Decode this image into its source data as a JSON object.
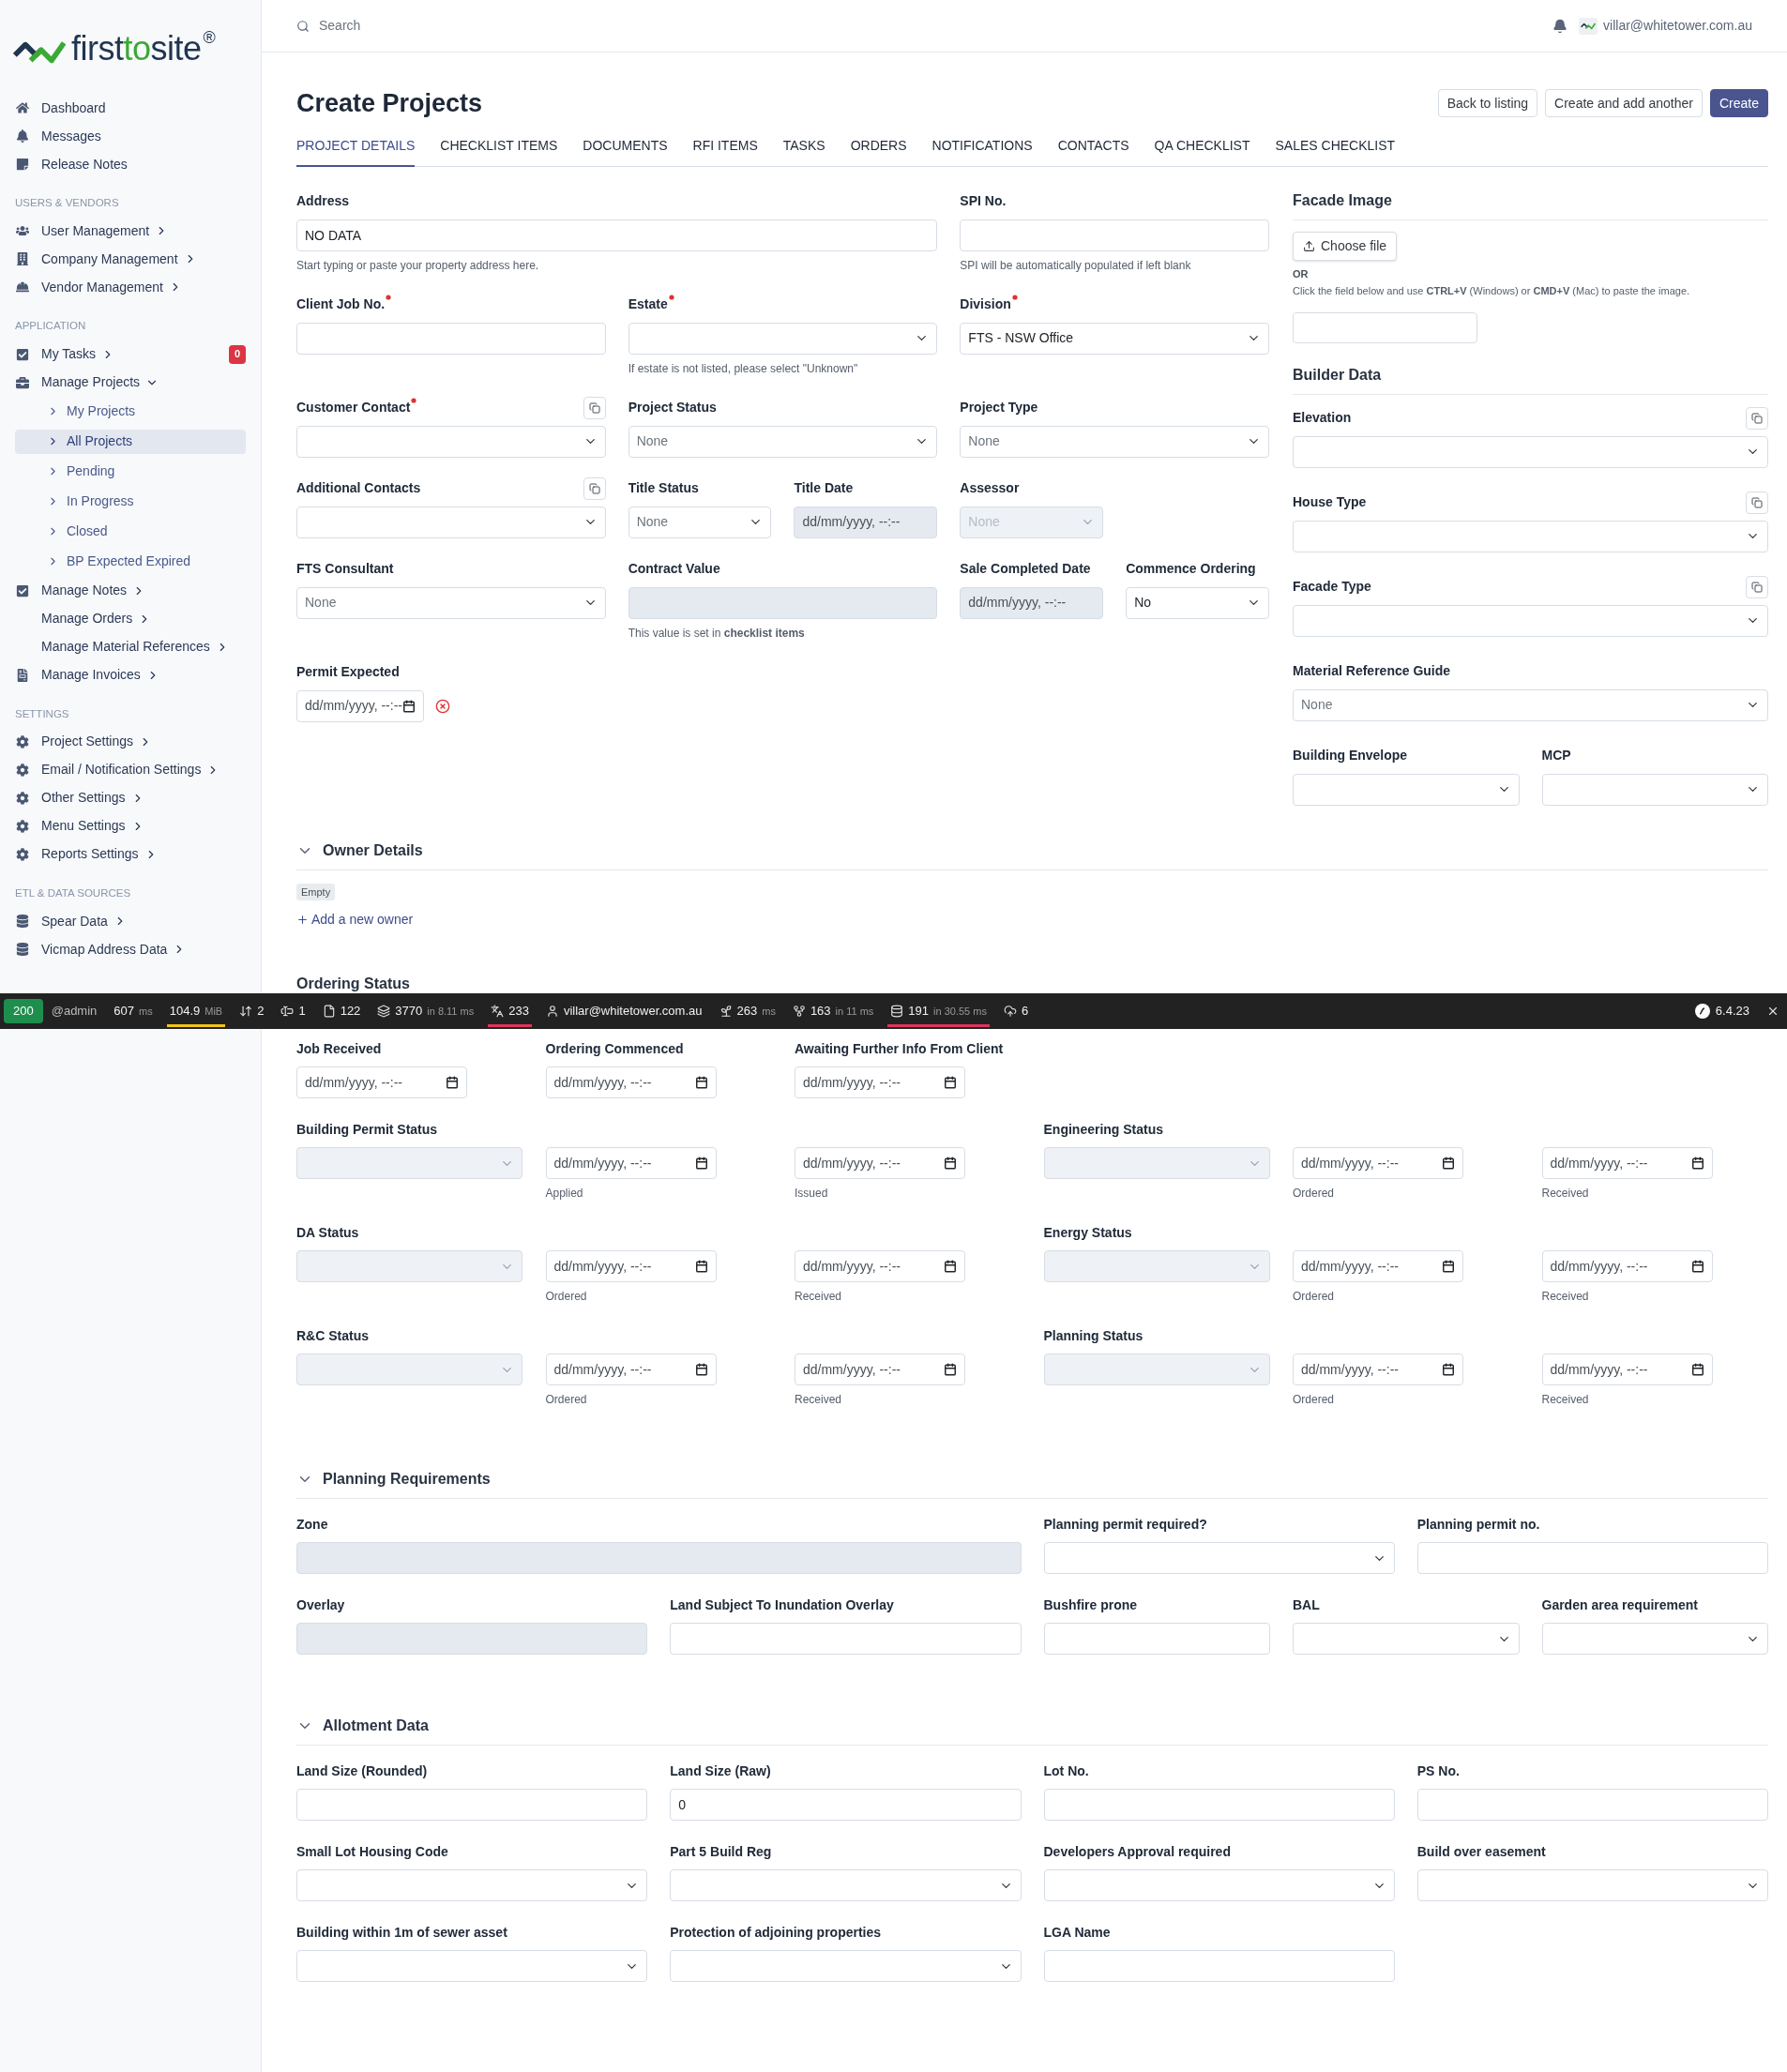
{
  "sidebar": {
    "logo": {
      "part_1": "first",
      "part_2": "to",
      "part_3": "site",
      "registered": "®"
    },
    "sections": [
      {
        "items": [
          {
            "label": "Dashboard"
          },
          {
            "label": "Messages"
          },
          {
            "label": "Release Notes"
          }
        ]
      },
      {
        "title": "USERS & VENDORS",
        "items": [
          {
            "label": "User Management",
            "expanded": false
          },
          {
            "label": "Company Management",
            "expanded": false
          },
          {
            "label": "Vendor Management",
            "expanded": false
          }
        ]
      },
      {
        "title": "APPLICATION",
        "items": [
          {
            "label": "My Tasks",
            "expanded": false,
            "badge": "0"
          },
          {
            "label": "Manage Projects",
            "expanded": true,
            "children": [
              {
                "label": "My Projects",
                "selected": false
              },
              {
                "label": "All Projects",
                "selected": true
              },
              {
                "label": "Pending",
                "selected": false
              },
              {
                "label": "In Progress",
                "selected": false
              },
              {
                "label": "Closed",
                "selected": false
              },
              {
                "label": "BP Expected Expired",
                "selected": false
              }
            ]
          },
          {
            "label": "Manage Notes",
            "expanded": false
          },
          {
            "label": "Manage Orders",
            "expanded": false
          },
          {
            "label": "Manage Material References",
            "expanded": false
          },
          {
            "label": "Manage Invoices",
            "expanded": false
          }
        ]
      },
      {
        "title": "SETTINGS",
        "items": [
          {
            "label": "Project Settings",
            "expanded": false
          },
          {
            "label": "Email / Notification Settings",
            "expanded": false
          },
          {
            "label": "Other Settings",
            "expanded": false
          },
          {
            "label": "Menu Settings",
            "expanded": false
          },
          {
            "label": "Reports Settings",
            "expanded": false
          }
        ]
      },
      {
        "title": "ETL & DATA SOURCES",
        "items": [
          {
            "label": "Spear Data",
            "expanded": false
          },
          {
            "label": "Vicmap Address Data",
            "expanded": false
          }
        ]
      }
    ]
  },
  "header": {
    "search": {
      "placeholder": "Search"
    },
    "user": {
      "email": "villar@whitetower.com.au"
    }
  },
  "page": {
    "title": "Create Projects",
    "actions": [
      {
        "label": "Back to listing",
        "primary": false
      },
      {
        "label": "Create and add another",
        "primary": false
      },
      {
        "label": "Create",
        "primary": true
      }
    ],
    "tabs": [
      {
        "label": "PROJECT DETAILS",
        "selected": true
      },
      {
        "label": "CHECKLIST ITEMS",
        "selected": false
      },
      {
        "label": "DOCUMENTS",
        "selected": false
      },
      {
        "label": "RFI ITEMS",
        "selected": false
      },
      {
        "label": "TASKS",
        "selected": false
      },
      {
        "label": "ORDERS",
        "selected": false
      },
      {
        "label": "NOTIFICATIONS",
        "selected": false
      },
      {
        "label": "CONTACTS",
        "selected": false
      },
      {
        "label": "QA CHECKLIST",
        "selected": false
      },
      {
        "label": "SALES CHECKLIST",
        "selected": false
      }
    ]
  },
  "form": {
    "rows": [
      [
        {
          "label": "Address",
          "kind": "text",
          "disabled": false,
          "value": "NO DATA",
          "help": "Start typing or paste your property address here."
        },
        null,
        {
          "label": "SPI No.",
          "kind": "text",
          "disabled": false,
          "help": "SPI will be automatically populated if left blank"
        }
      ],
      [
        {
          "label": "Client Job No.",
          "kind": "text",
          "required": true,
          "disabled": false
        },
        {
          "label": "Estate",
          "kind": "select",
          "required": true,
          "disabled": false,
          "help": "If estate is not listed, please select \"Unknown\""
        },
        {
          "label": "Division",
          "kind": "select",
          "required": true,
          "disabled": false,
          "value": "FTS - NSW Office"
        }
      ],
      [
        {
          "label": "Customer Contact",
          "kind": "select",
          "required": true,
          "disabled": false,
          "copy": true
        },
        {
          "label": "Project Status",
          "kind": "select",
          "disabled": false,
          "placeholder": "None"
        },
        {
          "label": "Project Type",
          "kind": "select",
          "disabled": false,
          "placeholder": "None"
        }
      ],
      [
        {
          "label": "Additional Contacts",
          "kind": "select",
          "disabled": false,
          "copy": true
        },
        {
          "kind": "pair",
          "fields": [
            {
              "label": "Title Status",
              "kind": "select",
              "disabled": false,
              "placeholder": "None"
            },
            {
              "label": "Title Date",
              "kind": "date",
              "disabled": true,
              "placeholder": "dd/mm/yyyy, --:--"
            }
          ]
        },
        {
          "label": "Assessor",
          "kind": "select",
          "disabled": true,
          "placeholder": "None"
        }
      ],
      [
        {
          "label": "FTS Consultant",
          "kind": "select",
          "disabled": false,
          "placeholder": "None"
        },
        {
          "label": "Contract Value",
          "kind": "text",
          "disabled": true,
          "help": "This value is set in **checklist items**"
        },
        {
          "kind": "pair",
          "fields": [
            {
              "label": "Sale Completed Date",
              "kind": "date",
              "disabled": true,
              "placeholder": "dd/mm/yyyy, --:--"
            },
            {
              "label": "Commence Ordering",
              "kind": "select",
              "disabled": false,
              "value": "No"
            }
          ]
        }
      ],
      [
        {
          "label": "Permit Expected",
          "kind": "date",
          "disabled": false,
          "placeholder": "dd/mm/yyyy, --:--",
          "clear": true
        }
      ]
    ]
  },
  "facade_image": {
    "title": "Facade Image",
    "button": "Choose file",
    "separator": "OR",
    "help": "Click the field below and use **CTRL+V** (Windows) or **CMD+V** (Mac) to paste the image."
  },
  "builder_data": {
    "title": "Builder Data",
    "fields": [
      {
        "label": "Elevation",
        "kind": "select",
        "disabled": false,
        "copy": true
      },
      {
        "label": "House Type",
        "kind": "select",
        "disabled": false,
        "copy": true
      },
      {
        "label": "Facade Type",
        "kind": "select",
        "disabled": false,
        "copy": true
      },
      {
        "label": "Material Reference Guide",
        "kind": "select",
        "disabled": false,
        "placeholder": "None"
      },
      {
        "label": "Building Envelope",
        "kind": "select",
        "disabled": false
      },
      {
        "label": "MCP",
        "kind": "select",
        "disabled": false
      }
    ]
  },
  "owner_details": {
    "title": "Owner Details",
    "expanded": true,
    "status": "Empty",
    "add_link": "Add a new owner"
  },
  "ordering_status": {
    "title": "Ordering Status",
    "dates": [
      {
        "label": "Job Received",
        "kind": "date",
        "disabled": false,
        "placeholder": "dd/mm/yyyy, --:--"
      },
      {
        "label": "Ordering Commenced",
        "kind": "date",
        "disabled": false,
        "placeholder": "dd/mm/yyyy, --:--"
      },
      {
        "label": "Awaiting Further Info From Client",
        "kind": "date",
        "disabled": false,
        "placeholder": "dd/mm/yyyy, --:--"
      }
    ],
    "groups": [
      {
        "label": "Building Permit Status",
        "fields": [
          {
            "kind": "select",
            "disabled": true
          },
          {
            "kind": "date",
            "disabled": false,
            "placeholder": "dd/mm/yyyy, --:--",
            "help": "Applied"
          },
          {
            "kind": "date",
            "disabled": false,
            "placeholder": "dd/mm/yyyy, --:--",
            "help": "Issued"
          }
        ]
      },
      {
        "label": "Engineering Status",
        "fields": [
          {
            "kind": "select",
            "disabled": true
          },
          {
            "kind": "date",
            "disabled": false,
            "placeholder": "dd/mm/yyyy, --:--",
            "help": "Ordered"
          },
          {
            "kind": "date",
            "disabled": false,
            "placeholder": "dd/mm/yyyy, --:--",
            "help": "Received"
          }
        ]
      },
      {
        "label": "DA Status",
        "fields": [
          {
            "kind": "select",
            "disabled": true
          },
          {
            "kind": "date",
            "disabled": false,
            "placeholder": "dd/mm/yyyy, --:--",
            "help": "Ordered"
          },
          {
            "kind": "date",
            "disabled": false,
            "placeholder": "dd/mm/yyyy, --:--",
            "help": "Received"
          }
        ]
      },
      {
        "label": "Energy Status",
        "fields": [
          {
            "kind": "select",
            "disabled": true
          },
          {
            "kind": "date",
            "disabled": false,
            "placeholder": "dd/mm/yyyy, --:--",
            "help": "Ordered"
          },
          {
            "kind": "date",
            "disabled": false,
            "placeholder": "dd/mm/yyyy, --:--",
            "help": "Received"
          }
        ]
      },
      {
        "label": "R&C Status",
        "fields": [
          {
            "kind": "select",
            "disabled": true
          },
          {
            "kind": "date",
            "disabled": false,
            "placeholder": "dd/mm/yyyy, --:--",
            "help": "Ordered"
          },
          {
            "kind": "date",
            "disabled": false,
            "placeholder": "dd/mm/yyyy, --:--",
            "help": "Received"
          }
        ]
      },
      {
        "label": "Planning Status",
        "fields": [
          {
            "kind": "select",
            "disabled": true
          },
          {
            "kind": "date",
            "disabled": false,
            "placeholder": "dd/mm/yyyy, --:--",
            "help": "Ordered"
          },
          {
            "kind": "date",
            "disabled": false,
            "placeholder": "dd/mm/yyyy, --:--",
            "help": "Received"
          }
        ]
      }
    ]
  },
  "planning_requirements": {
    "title": "Planning Requirements",
    "expanded": true,
    "rows": [
      [
        {
          "label": "Zone",
          "kind": "text",
          "disabled": true
        },
        null,
        {
          "label": "Planning permit required?",
          "kind": "select",
          "disabled": false
        },
        {
          "label": "Planning permit no.",
          "kind": "text",
          "disabled": false
        }
      ],
      [
        {
          "label": "Overlay",
          "kind": "text",
          "disabled": true
        },
        {
          "label": "Land Subject To Inundation Overlay",
          "kind": "text",
          "disabled": false
        },
        {
          "label": "Bushfire prone",
          "kind": "text",
          "disabled": false
        },
        {
          "label": "BAL",
          "kind": "select",
          "disabled": false
        },
        {
          "label": "Garden area requirement",
          "kind": "select",
          "disabled": false
        }
      ]
    ]
  },
  "allotment_data": {
    "title": "Allotment Data",
    "expanded": true,
    "rows": [
      [
        {
          "label": "Land Size (Rounded)",
          "kind": "text",
          "disabled": false
        },
        {
          "label": "Land Size (Raw)",
          "kind": "text",
          "disabled": false,
          "value": "0"
        },
        {
          "label": "Lot No.",
          "kind": "text",
          "disabled": false
        },
        {
          "label": "PS No.",
          "kind": "text",
          "disabled": false
        }
      ],
      [
        {
          "label": "Small Lot Housing Code",
          "kind": "select",
          "disabled": false
        },
        {
          "label": "Part 5 Build Reg",
          "kind": "select",
          "disabled": false
        },
        {
          "label": "Developers Approval required",
          "kind": "select",
          "disabled": false
        },
        {
          "label": "Build over easement",
          "kind": "select",
          "disabled": false
        }
      ],
      [
        {
          "label": "Building within 1m of sewer asset",
          "kind": "select",
          "disabled": false
        },
        {
          "label": "Protection of adjoining properties",
          "kind": "select",
          "disabled": false
        },
        {
          "label": "LGA Name",
          "kind": "text",
          "disabled": false
        }
      ]
    ]
  },
  "debug_bar": {
    "status": "200",
    "items": [
      {
        "value": "@admin"
      },
      {
        "value": "607",
        "unit": "ms"
      },
      {
        "value": "104.9",
        "unit": "MiB",
        "color": "#f0c419"
      },
      {
        "value": "2"
      },
      {
        "value": "1"
      },
      {
        "value": "122"
      },
      {
        "value": "3770",
        "unit": "in 8.11 ms"
      },
      {
        "value": "233",
        "color": "#e0345a"
      },
      {
        "value": "villar@whitetower.com.au"
      },
      {
        "value": "263",
        "unit": "ms"
      },
      {
        "value": "163",
        "unit": "in 11 ms"
      },
      {
        "value": "191",
        "unit": "in 30.55 ms",
        "color": "#e0345a"
      },
      {
        "value": "6"
      }
    ],
    "version": "6.4.23"
  }
}
